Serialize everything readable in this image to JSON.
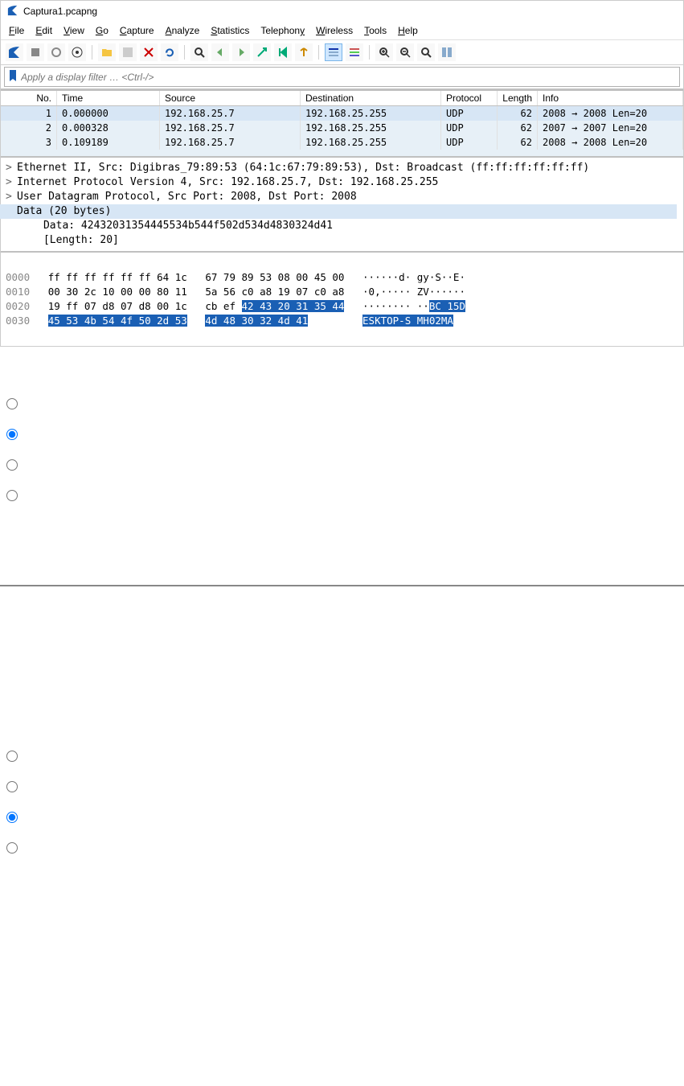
{
  "window": {
    "title": "Captura1.pcapng"
  },
  "menubar": [
    "File",
    "Edit",
    "View",
    "Go",
    "Capture",
    "Analyze",
    "Statistics",
    "Telephony",
    "Wireless",
    "Tools",
    "Help"
  ],
  "filter": {
    "placeholder": "Apply a display filter … <Ctrl-/>"
  },
  "packet_headers": [
    "No.",
    "Time",
    "Source",
    "Destination",
    "Protocol",
    "Length",
    "Info"
  ],
  "packets": [
    {
      "no": "1",
      "time": "0.000000",
      "src": "192.168.25.7",
      "dst": "192.168.25.255",
      "proto": "UDP",
      "len": "62",
      "info_a": "2008",
      "info_b": "2008",
      "info_c": "Len=20"
    },
    {
      "no": "2",
      "time": "0.000328",
      "src": "192.168.25.7",
      "dst": "192.168.25.255",
      "proto": "UDP",
      "len": "62",
      "info_a": "2007",
      "info_b": "2007",
      "info_c": "Len=20"
    },
    {
      "no": "3",
      "time": "0.109189",
      "src": "192.168.25.7",
      "dst": "192.168.25.255",
      "proto": "UDP",
      "len": "62",
      "info_a": "2008",
      "info_b": "2008",
      "info_c": "Len=20"
    }
  ],
  "details": {
    "eth": "Ethernet II, Src: Digibras_79:89:53 (64:1c:67:79:89:53), Dst: Broadcast (ff:ff:ff:ff:ff:ff)",
    "ip": "Internet Protocol Version 4, Src: 192.168.25.7, Dst: 192.168.25.255",
    "udp": "User Datagram Protocol, Src Port: 2008, Dst Port: 2008",
    "data_hdr": "Data (20 bytes)",
    "data_line": "Data: 42432031354445534b544f502d534d4830324d41",
    "len_line": "[Length: 20]"
  },
  "hex": {
    "rows": [
      {
        "off": "0000",
        "b1": "ff ff ff ff ff ff 64 1c",
        "b2": "67 79 89 53 08 00 45 00",
        "a": "······d· gy·S··E·"
      },
      {
        "off": "0010",
        "b1": "00 30 2c 10 00 00 80 11",
        "b2": "5a 56 c0 a8 19 07 c0 a8",
        "a": "·0,····· ZV······"
      },
      {
        "off": "0020",
        "b1": "19 ff 07 d8 07 d8 00 1c",
        "b2": "cb ef ",
        "b2h": "42 43 20 31 35 44",
        "a": "········ ··",
        "ah": "BC 15D"
      },
      {
        "off": "0030",
        "b1h": "45 53 4b 54 4f 50 2d 53",
        "b2h": "4d 48 30 32 4d 41",
        "ah": "ESKTOP-S MH02MA"
      }
    ]
  },
  "radio_groups": {
    "g1": {
      "selected": 1,
      "count": 4
    },
    "g2": {
      "selected": 2,
      "count": 4
    }
  }
}
